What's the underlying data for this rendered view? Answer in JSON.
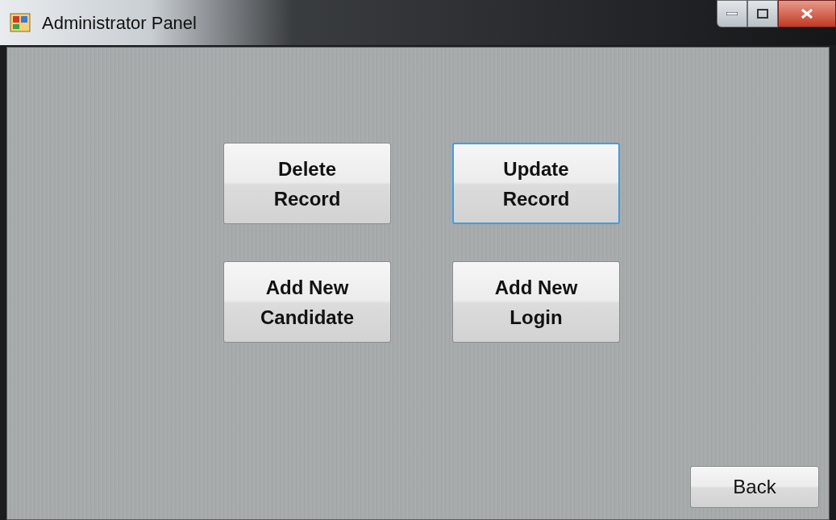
{
  "window": {
    "title": "Administrator Panel"
  },
  "buttons": [
    {
      "label": "Delete\nRecord",
      "selected": false
    },
    {
      "label": "Update\nRecord",
      "selected": true
    },
    {
      "label": "Add New\nCandidate",
      "selected": false
    },
    {
      "label": "Add New\nLogin",
      "selected": false
    }
  ],
  "back_button": {
    "label": "Back"
  }
}
